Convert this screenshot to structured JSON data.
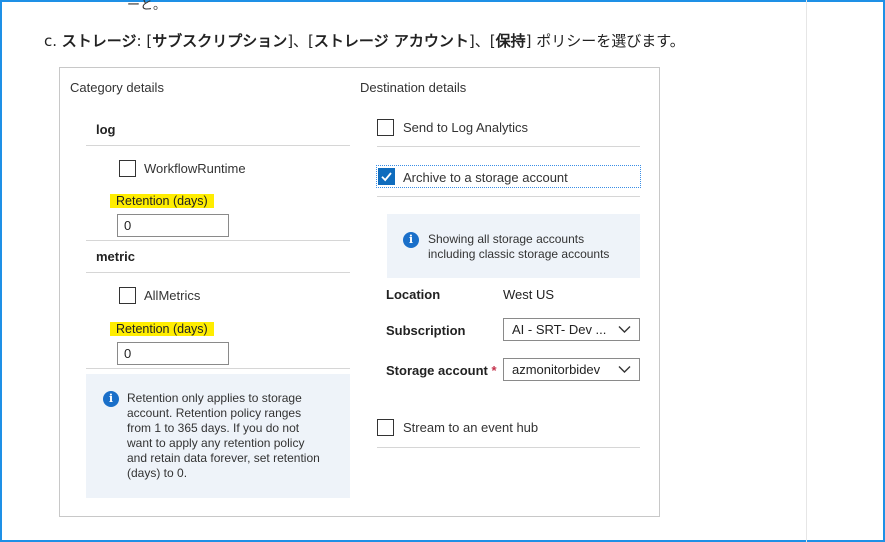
{
  "step": {
    "letter": "c.",
    "parts": [
      {
        "t": "ストレージ",
        "b": true
      },
      {
        "t": ": [",
        "b": false
      },
      {
        "t": "サブスクリプション",
        "b": true
      },
      {
        "t": "]、[",
        "b": false
      },
      {
        "t": "ストレージ アカウント",
        "b": true
      },
      {
        "t": "]、[",
        "b": false
      },
      {
        "t": "保持",
        "b": true
      },
      {
        "t": "] ポリシーを選びます。",
        "b": false
      }
    ]
  },
  "top_cut": "ーと。",
  "category": {
    "header": "Category details",
    "log_title": "log",
    "workflow_label": "WorkflowRuntime",
    "retention_label_1": "Retention (days)",
    "retention_value_1": "0",
    "metric_title": "metric",
    "allmetrics_label": "AllMetrics",
    "retention_label_2": "Retention (days)",
    "retention_value_2": "0",
    "info_lines": [
      "Retention only applies to storage",
      "account. Retention policy ranges",
      "from 1 to 365 days. If you do not",
      "want to apply any retention policy",
      "and retain data forever, set retention",
      "(days) to 0."
    ]
  },
  "destination": {
    "header": "Destination details",
    "log_analytics_label": "Send to Log Analytics",
    "archive_label": "Archive to a storage account",
    "archive_checked": true,
    "info_lines": [
      "Showing all storage accounts",
      "including classic storage accounts"
    ],
    "location_label": "Location",
    "location_value": "West US",
    "subscription_label": "Subscription",
    "subscription_value": "AI - SRT- Dev ...",
    "storage_label": "Storage account",
    "required_mark": "*",
    "storage_value": "azmonitorbidev",
    "event_hub_label": "Stream to an event hub"
  },
  "colors": {
    "accent": "#0f6cbd",
    "highlight": "#ffed00",
    "frame": "#1e90e6",
    "info_bg": "#eef3f9"
  }
}
